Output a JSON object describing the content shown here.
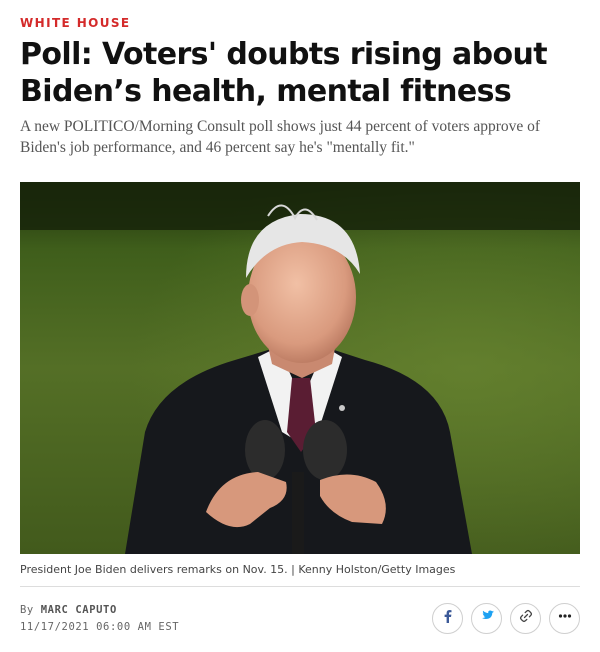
{
  "article": {
    "kicker": "WHITE HOUSE",
    "headline": "Poll: Voters' doubts rising about Biden’s health, mental fitness",
    "dek": "A new POLITICO/Morning Consult poll shows just 44 percent of voters approve of Biden's job performance, and 46 percent say he's \"mentally fit.\"",
    "caption": "President Joe Biden delivers remarks on Nov. 15. | Kenny Holston/Getty Images",
    "byline_prefix": "By",
    "author": "MARC CAPUTO",
    "timestamp": "11/17/2021 06:00 AM EST"
  },
  "share": {
    "icons": [
      "facebook-icon",
      "twitter-icon",
      "link-icon",
      "more-icon"
    ]
  },
  "colors": {
    "kicker": "#d42a2a",
    "facebook": "#3b5998",
    "twitter": "#1da1f2"
  }
}
